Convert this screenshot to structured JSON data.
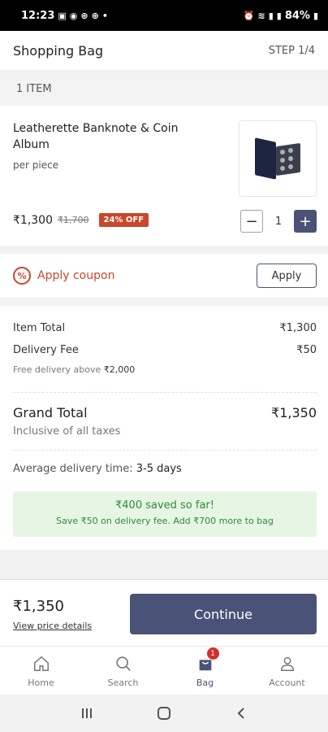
{
  "status_bar": {
    "time": "12:23",
    "battery": "84%"
  },
  "header": {
    "title": "Shopping Bag",
    "step": "STEP 1/4"
  },
  "bag": {
    "item_count": "1 ITEM"
  },
  "product": {
    "name": "Leatherette Banknote & Coin Album",
    "unit": "per piece",
    "price": "₹1,300",
    "mrp": "₹1,700",
    "discount": "24% OFF",
    "quantity": "1",
    "minus": "−",
    "plus": "+"
  },
  "coupon": {
    "label": "Apply coupon",
    "button": "Apply",
    "icon": "%"
  },
  "summary": {
    "item_total_label": "Item Total",
    "item_total_value": "₹1,300",
    "delivery_fee_label": "Delivery Fee",
    "delivery_fee_value": "₹50",
    "free_delivery_note": "Free delivery above",
    "free_delivery_amount": "₹2,000",
    "grand_total_label": "Grand Total",
    "grand_total_value": "₹1,350",
    "taxes_note": "Inclusive of all taxes",
    "delivery_time_label": "Average delivery time:",
    "delivery_time_value": "3-5 days",
    "saved_title": "₹400 saved so far!",
    "saved_subtitle": "Save ₹50 on delivery fee. Add ₹700 more to bag"
  },
  "footer": {
    "total": "₹1,350",
    "price_details_link": "View price details",
    "continue_button": "Continue"
  },
  "tabs": [
    {
      "label": "Home",
      "icon": "home-icon"
    },
    {
      "label": "Search",
      "icon": "search-icon"
    },
    {
      "label": "Bag",
      "icon": "bag-icon",
      "badge": "1"
    },
    {
      "label": "Account",
      "icon": "account-icon"
    }
  ],
  "colors": {
    "accent": "#4a5278",
    "discount": "#c9472b",
    "success": "#2e8b38"
  }
}
